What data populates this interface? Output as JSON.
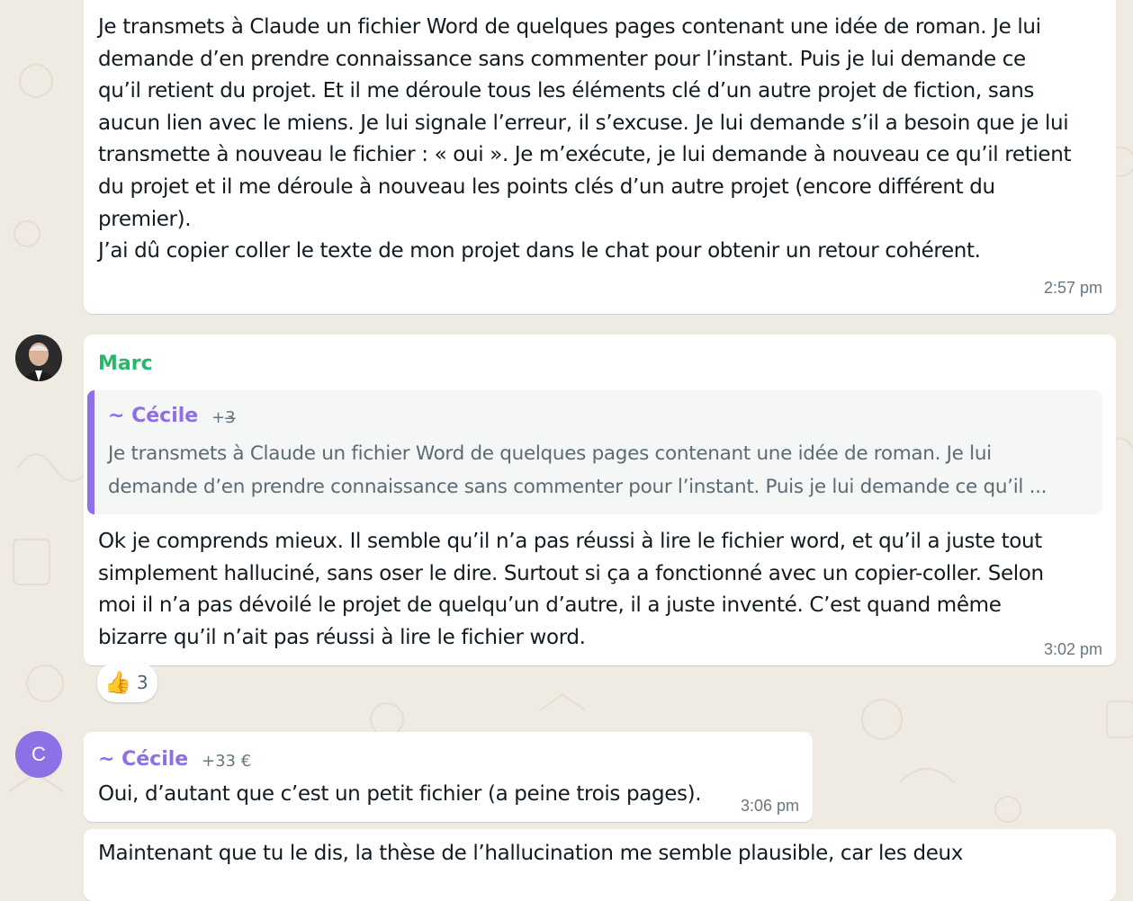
{
  "messages": [
    {
      "text": "Je transmets à Claude un fichier Word de quelques pages contenant une idée de roman. Je lui\ndemande d’en prendre connaissance sans commenter pour l’instant. Puis je lui demande ce\nqu’il retient du projet. Et il me déroule tous les éléments clé d’un autre projet de fiction, sans\naucun lien avec le miens. Je lui signale l’erreur, il s’excuse. Je lui demande s’il a besoin que je lui\ntransmette à nouveau le fichier : « oui ». Je m’exécute, je lui demande à nouveau ce qu’il retient\ndu projet et il me déroule à nouveau les points clés d’un autre projet (encore différent du\npremier).\nJ’ai dû copier coller le texte de mon projet dans le chat pour obtenir un retour cohérent.",
      "time": "2:57 pm"
    },
    {
      "sender": "Marc",
      "quote": {
        "sender": "~ Cécile",
        "phone": "+3̶",
        "text": "Je transmets à Claude un fichier Word de quelques pages contenant une idée de roman. Je lui\ndemande d’en prendre connaissance sans commenter pour l’instant. Puis je lui demande ce qu’il ..."
      },
      "text": "Ok je comprends mieux. Il semble qu’il n’a pas réussi à lire le fichier word, et qu’il a juste tout\nsimplement halluciné, sans oser le dire. Surtout si ça a fonctionné avec un copier-coller. Selon\nmoi il n’a pas dévoilé le projet de quelqu’un d’autre, il a juste inventé. C’est quand même\nbizarre qu’il n’ait pas réussi à lire le fichier word.",
      "time": "3:02 pm",
      "reaction": {
        "emoji": "👍",
        "count": "3"
      }
    },
    {
      "avatar_letter": "C",
      "sender": "~ Cécile",
      "phone": "+33 €",
      "text": "Oui, d’autant que c’est un petit fichier (a peine trois pages).",
      "time": "3:06 pm"
    },
    {
      "text": "Maintenant que tu le dis, la thèse de l’hallucination me semble plausible, car les deux"
    }
  ],
  "colors": {
    "marc_name": "#25b86a",
    "cecile_name": "#8d6fe6",
    "cecile_avatar": "#8d6fe6",
    "quote_bar": "#8d6fe6"
  }
}
